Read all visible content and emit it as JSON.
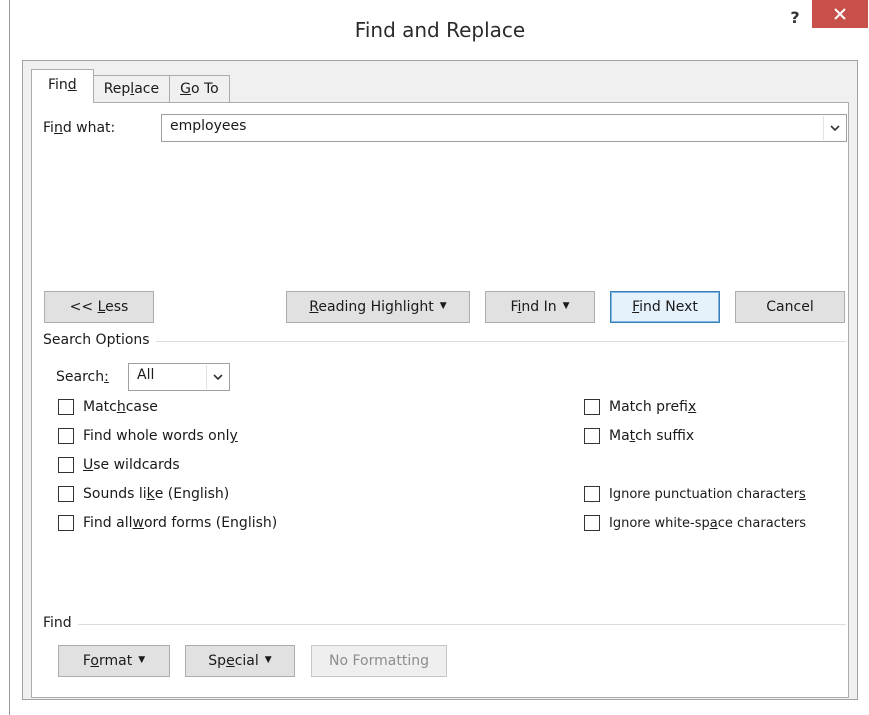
{
  "window": {
    "title": "Find and Replace",
    "help_label": "?",
    "close_icon": "close-icon",
    "accent_close": "#c7504a"
  },
  "tabs": [
    {
      "pre": "Fin",
      "key": "d",
      "post": "",
      "active": true
    },
    {
      "pre": "Rep",
      "key": "l",
      "post": "ace",
      "active": false
    },
    {
      "pre": "",
      "key": "G",
      "post": "o To",
      "active": false
    }
  ],
  "find_what": {
    "label_pre": "Fi",
    "label_key": "n",
    "label_post": "d what:",
    "value": "employees"
  },
  "buttons": {
    "less": {
      "pre": "<< ",
      "key": "L",
      "post": "ess"
    },
    "reading_highlight": {
      "pre": "",
      "key": "R",
      "post": "eading Highlight"
    },
    "find_in": {
      "pre": "F",
      "key": "i",
      "post": "nd In"
    },
    "find_next": {
      "pre": "",
      "key": "F",
      "post": "ind Next"
    },
    "cancel": "Cancel"
  },
  "search_options": {
    "title": "Search Options",
    "search_label_pre": "Search",
    "search_label_key": ":",
    "search_label_post": "",
    "search_value": "All",
    "left": [
      {
        "pre": "Matc",
        "key": "h",
        "post": " case",
        "checked": false
      },
      {
        "pre": "Find whole words onl",
        "key": "y",
        "post": "",
        "checked": false
      },
      {
        "pre": "",
        "key": "U",
        "post": "se wildcards",
        "checked": false
      },
      {
        "pre": "Sounds li",
        "key": "k",
        "post": "e (English)",
        "checked": false
      },
      {
        "pre": "Find all ",
        "key": "w",
        "post": "ord forms (English)",
        "checked": false
      }
    ],
    "right": [
      {
        "pre": "Match prefi",
        "key": "x",
        "post": "",
        "checked": false
      },
      {
        "pre": "Ma",
        "key": "t",
        "post": "ch suffix",
        "checked": false
      },
      {
        "pre": "Ignore punctuation character",
        "key": "s",
        "post": "",
        "checked": false
      },
      {
        "pre": "Ignore white-sp",
        "key": "a",
        "post": "ce characters",
        "checked": false
      }
    ]
  },
  "find_group": {
    "title": "Find",
    "format": {
      "pre": "F",
      "key": "o",
      "post": "rmat"
    },
    "special": {
      "pre": "Sp",
      "key": "e",
      "post": "cial"
    },
    "no_formatting": "No Formatting"
  }
}
